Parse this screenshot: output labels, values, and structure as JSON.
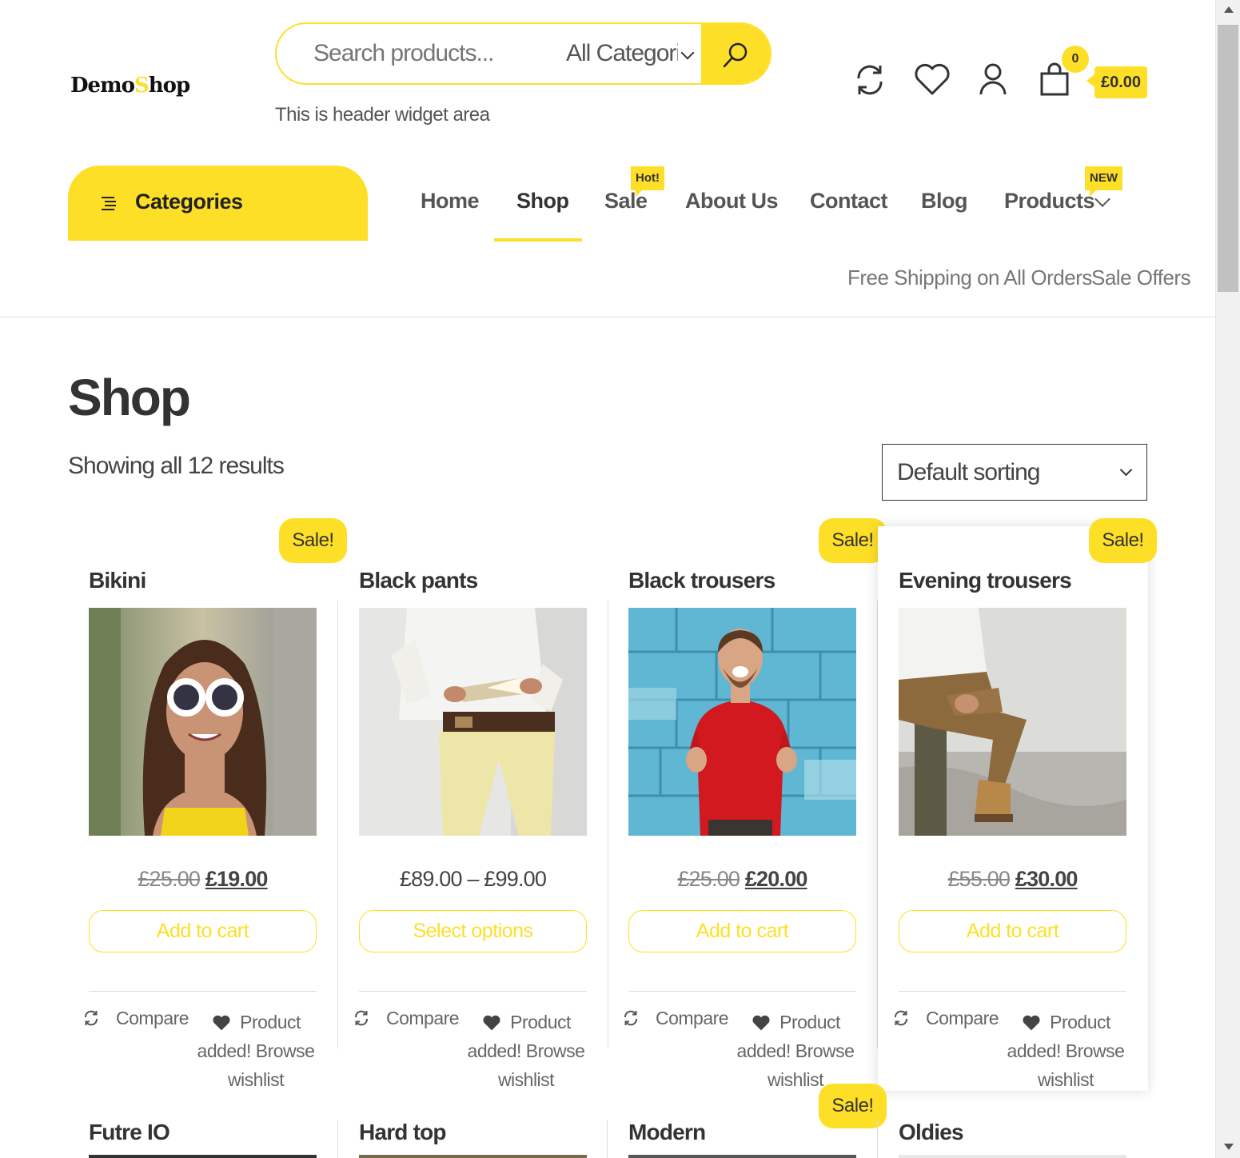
{
  "header": {
    "logo": {
      "part1": "Demo",
      "part2": "Shop"
    },
    "search": {
      "placeholder": "Search products...",
      "category": "All Categories"
    },
    "widget_text": "This is header widget area",
    "cart": {
      "count": "0",
      "total": "£0.00"
    },
    "icons": [
      "compare-icon",
      "heart-icon",
      "user-icon",
      "bag-icon"
    ]
  },
  "nav": {
    "categories_label": "Categories",
    "items": [
      {
        "label": "Home"
      },
      {
        "label": "Shop"
      },
      {
        "label": "Sale",
        "badge": "Hot!"
      },
      {
        "label": "About Us"
      },
      {
        "label": "Contact"
      },
      {
        "label": "Blog"
      },
      {
        "label": "Products",
        "badge": "NEW"
      }
    ],
    "active": "Shop",
    "top_links": [
      "Free Shipping on All Orders",
      "Sale Offers"
    ]
  },
  "page": {
    "title": "Shop",
    "results": "Showing all 12 results",
    "sort": "Default sorting"
  },
  "products": [
    {
      "title": "Bikini",
      "sale": "Sale!",
      "old_price": "£25.00",
      "price": "£19.00",
      "button": "Add to cart",
      "compare": "Compare",
      "wishlist": "Product added! Browse wishlist"
    },
    {
      "title": "Black pants",
      "sale": "",
      "price_range": "£89.00 – £99.00",
      "button": "Select options",
      "compare": "Compare",
      "wishlist": "Product added! Browse wishlist"
    },
    {
      "title": "Black trousers",
      "sale": "Sale!",
      "old_price": "£25.00",
      "price": "£20.00",
      "button": "Add to cart",
      "compare": "Compare",
      "wishlist": "Product added! Browse wishlist"
    },
    {
      "title": "Evening trousers",
      "sale": "Sale!",
      "old_price": "£55.00",
      "price": "£30.00",
      "button": "Add to cart",
      "compare": "Compare",
      "wishlist": "Product added! Browse wishlist"
    }
  ],
  "products_row2": [
    {
      "title": "Futre IO"
    },
    {
      "title": "Hard top"
    },
    {
      "title": "Modern",
      "sale": "Sale!"
    },
    {
      "title": "Oldies"
    }
  ],
  "colors": {
    "accent": "#fedf27",
    "text": "#333333"
  }
}
